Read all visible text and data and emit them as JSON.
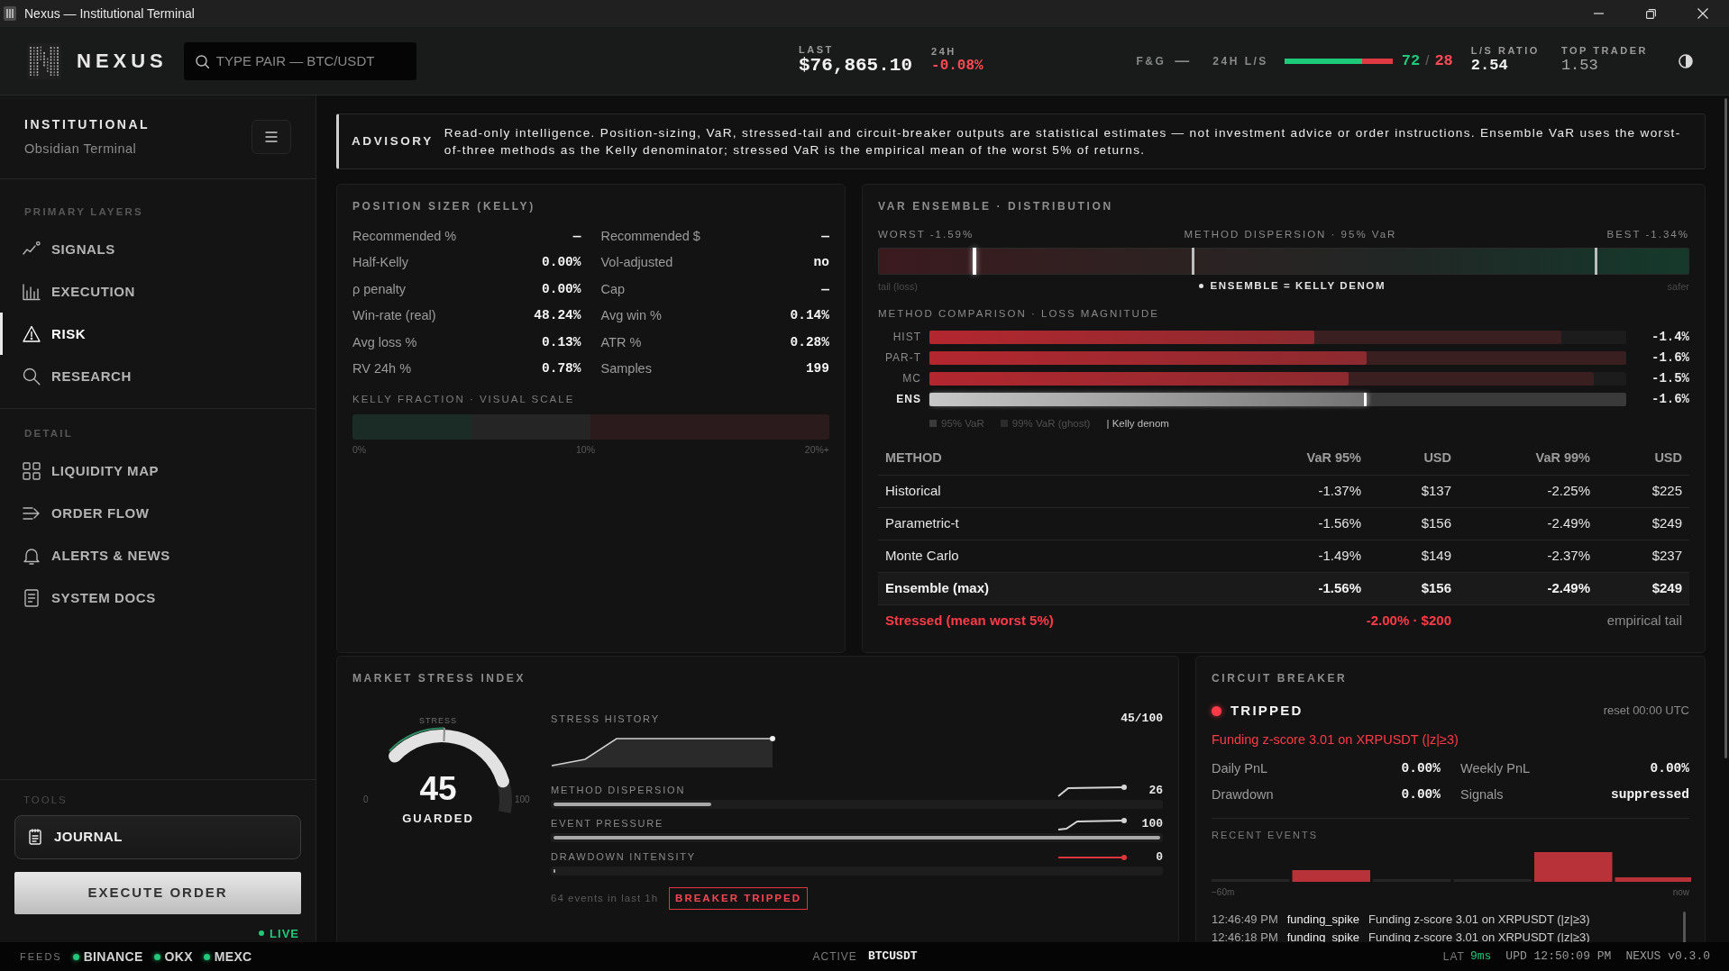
{
  "window": {
    "title": "Nexus — Institutional Terminal"
  },
  "header": {
    "brand": "NEXUS",
    "search": {
      "placeholder": "TYPE PAIR — BTC/USDT"
    },
    "quotes": [
      {
        "kind": "price",
        "label": "LAST",
        "value": "$76,865.10",
        "negative": false
      },
      {
        "kind": "change",
        "label": "24H",
        "value": "-0.08%",
        "negative": true
      }
    ],
    "fear_greed": {
      "label": "F&G",
      "value": "—"
    },
    "long_short": {
      "label": "24H L/S",
      "level": 0.72,
      "long": "72",
      "separator": "/",
      "short": "28"
    },
    "ratios": [
      {
        "label": "L/S RATIO",
        "value": "2.54",
        "emphasis": true
      },
      {
        "label": "TOP TRADER",
        "value": "1.53",
        "emphasis": false
      }
    ]
  },
  "sidebar": {
    "title": "INSTITUTIONAL",
    "subtitle": "Obsidian Terminal",
    "sections": [
      {
        "heading": "PRIMARY LAYERS",
        "items": [
          {
            "label": "SIGNALS",
            "selected": false
          },
          {
            "label": "EXECUTION",
            "selected": false
          },
          {
            "label": "RISK",
            "selected": true
          },
          {
            "label": "RESEARCH",
            "selected": false
          }
        ]
      },
      {
        "heading": "DETAIL",
        "items": [
          {
            "label": "LIQUIDITY MAP",
            "selected": false
          },
          {
            "label": "ORDER FLOW",
            "selected": false
          },
          {
            "label": "ALERTS & NEWS",
            "selected": false
          },
          {
            "label": "SYSTEM DOCS",
            "selected": false
          }
        ]
      }
    ],
    "tools": {
      "heading": "TOOLS",
      "journal": "JOURNAL",
      "execute": "EXECUTE ORDER"
    },
    "live": {
      "label": "LIVE",
      "on": true
    }
  },
  "advisory": {
    "label": "ADVISORY",
    "text": "Read-only intelligence. Position-sizing, VaR, stressed-tail and circuit-breaker outputs are statistical estimates — not investment advice or order instructions. Ensemble VaR uses the worst-of-three methods as the Kelly denominator; stressed VaR is the empirical mean of the worst 5% of returns."
  },
  "position_sizer": {
    "title": "POSITION SIZER (KELLY)",
    "stats": [
      {
        "label": "Recommended %",
        "value": "—"
      },
      {
        "label": "Recommended $",
        "value": "—"
      },
      {
        "label": "Half-Kelly",
        "value": "0.00%"
      },
      {
        "label": "Vol-adjusted",
        "value": "no"
      },
      {
        "label": "ρ penalty",
        "value": "0.00%"
      },
      {
        "label": "Cap",
        "value": "—"
      },
      {
        "label": "Win-rate (real)",
        "value": "48.24%"
      },
      {
        "label": "Avg win %",
        "value": "0.14%"
      },
      {
        "label": "Avg loss %",
        "value": "0.13%"
      },
      {
        "label": "ATR %",
        "value": "0.28%"
      },
      {
        "label": "RV 24h %",
        "value": "0.78%"
      },
      {
        "label": "Samples",
        "value": "199"
      }
    ],
    "scale": {
      "title": "KELLY FRACTION · VISUAL SCALE",
      "ticks": [
        "0%",
        "10%",
        "20%+"
      ]
    }
  },
  "var_ensemble": {
    "title": "VAR ENSEMBLE · DISTRIBUTION",
    "dispersion": {
      "worst": "WORST -1.59%",
      "caption": "METHOD DISPERSION · 95% VaR",
      "best": "BEST -1.34%",
      "markers": [
        {
          "level": 0.117,
          "highlighted": true
        },
        {
          "level": 0.387,
          "highlighted": false
        },
        {
          "level": 0.885,
          "highlighted": false
        }
      ],
      "left_note": "tail (loss)",
      "center_note": "ENSEMBLE = KELLY DENOM",
      "right_note": "safer"
    },
    "comparison": {
      "title": "METHOD COMPARISON · LOSS MAGNITUDE",
      "methods": [
        {
          "kind": "method",
          "label": "HIST",
          "var95": {
            "level": 0.552
          },
          "var99": {
            "level": 0.907
          },
          "value": "-1.4%"
        },
        {
          "kind": "method",
          "label": "PAR-T",
          "var95": {
            "level": 0.628
          },
          "var99": {
            "level": 1
          },
          "value": "-1.6%"
        },
        {
          "kind": "method",
          "label": "MC",
          "var95": {
            "level": 0.601
          },
          "var99": {
            "level": 0.953
          },
          "value": "-1.5%"
        },
        {
          "kind": "ensemble",
          "label": "ENS",
          "var95": {
            "level": 0.628
          },
          "value": "-1.6%"
        }
      ],
      "legend": [
        {
          "kind": "swatch",
          "label": "95% VaR",
          "color": "#3a3a3a"
        },
        {
          "kind": "swatch",
          "label": "99% VaR (ghost)",
          "color": "#2c2c2c"
        },
        {
          "kind": "text",
          "label": "| Kelly denom"
        }
      ]
    },
    "table": {
      "columns": [
        "METHOD",
        "VaR 95%",
        "USD",
        "VaR 99%",
        "USD"
      ],
      "rows": [
        {
          "kind": "method",
          "cells": [
            "Historical",
            "-1.37%",
            "$137",
            "-2.25%",
            "$225"
          ]
        },
        {
          "kind": "method",
          "cells": [
            "Parametric-t",
            "-1.56%",
            "$156",
            "-2.49%",
            "$249"
          ]
        },
        {
          "kind": "method",
          "cells": [
            "Monte Carlo",
            "-1.49%",
            "$149",
            "-2.37%",
            "$237"
          ]
        },
        {
          "kind": "ensemble",
          "cells": [
            "Ensemble (max)",
            "-1.56%",
            "$156",
            "-2.49%",
            "$249"
          ]
        }
      ],
      "stressed": {
        "label": "Stressed (mean worst 5%)",
        "value": "-2.00% · $200",
        "note": "empirical tail"
      }
    }
  },
  "market_stress": {
    "title": "MARKET STRESS INDEX",
    "gauge": {
      "level": 0.45,
      "value": "45",
      "label": "GUARDED",
      "caption": "STRESS",
      "min": "0",
      "max": "100"
    },
    "history": {
      "label": "STRESS HISTORY",
      "value": "45/100"
    },
    "components": [
      {
        "label": "METHOD DISPERSION",
        "value": "26",
        "level": 0.26,
        "color": "#d4d4d4"
      },
      {
        "label": "EVENT PRESSURE",
        "value": "100",
        "level": 1,
        "color": "#d4d4d4"
      },
      {
        "label": "DRAWDOWN INTENSITY",
        "value": "0",
        "level": 0,
        "color": "#e0353d"
      }
    ],
    "footer": {
      "text": "64 events in last 1h",
      "badge": "BREAKER TRIPPED"
    }
  },
  "circuit_breaker": {
    "title": "CIRCUIT BREAKER",
    "status": {
      "label": "TRIPPED",
      "tripped": true
    },
    "reset": "reset 00:00 UTC",
    "reason": "Funding z-score 3.01 on XRPUSDT (|z|≥3)",
    "stats": [
      {
        "label": "Daily PnL",
        "value": "0.00%"
      },
      {
        "label": "Weekly PnL",
        "value": "0.00%"
      },
      {
        "label": "Drawdown",
        "value": "0.00%"
      },
      {
        "label": "Signals",
        "value": "suppressed"
      }
    ],
    "events_title": "RECENT EVENTS",
    "axis": [
      "−60m",
      "now"
    ],
    "events": [
      {
        "time": "12:46:49 PM",
        "type": "funding_spike",
        "message": "Funding z-score 3.01 on XRPUSDT (|z|≥3)"
      },
      {
        "time": "12:46:18 PM",
        "type": "funding_spike",
        "message": "Funding z-score 3.01 on XRPUSDT (|z|≥3)"
      }
    ]
  },
  "status_bar": {
    "feeds_label": "FEEDS",
    "feeds": [
      {
        "name": "BINANCE",
        "online": true
      },
      {
        "name": "OKX",
        "online": true
      },
      {
        "name": "MEXC",
        "online": true
      }
    ],
    "active": {
      "label": "ACTIVE",
      "value": "BTCUSDT"
    },
    "latency": {
      "label": "LAT",
      "value": "9ms"
    },
    "updated": "UPD 12:50:09 PM",
    "version": "NEXUS v0.3.0"
  }
}
